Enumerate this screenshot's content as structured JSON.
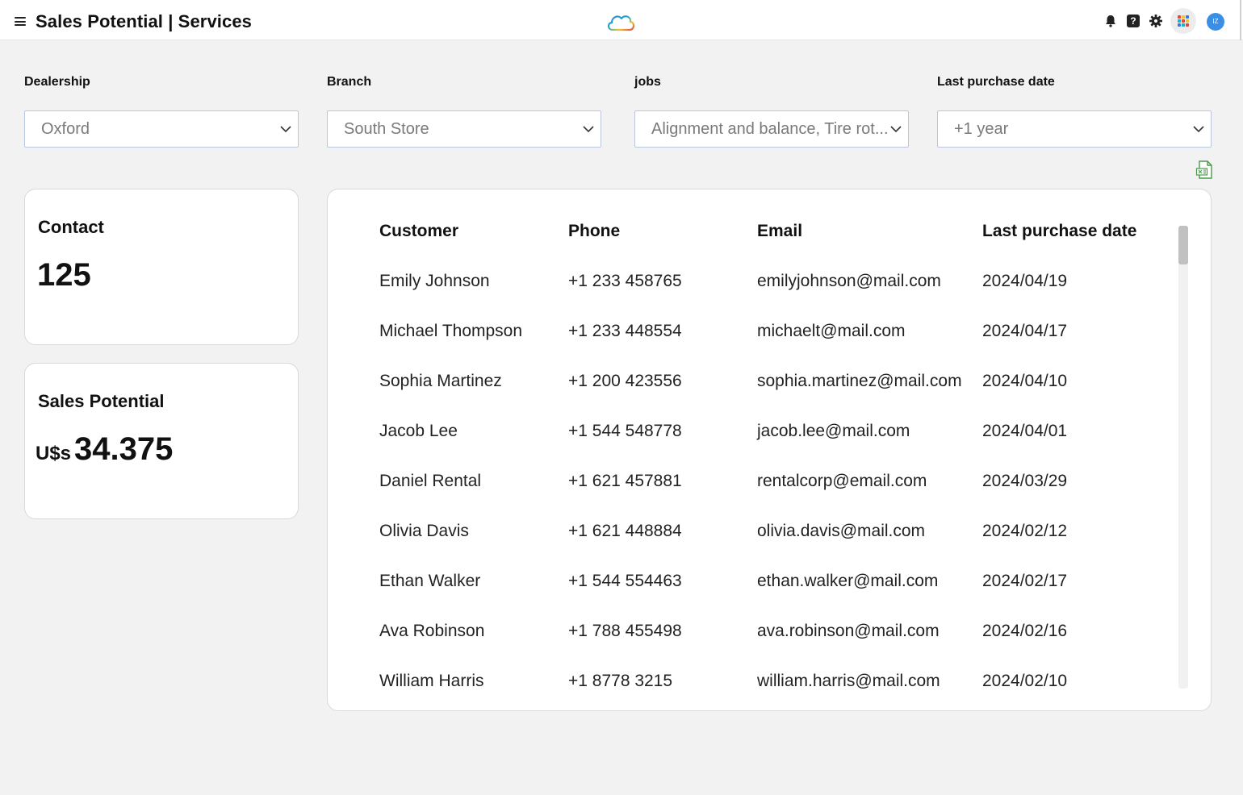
{
  "header": {
    "title": "Sales Potential | Services",
    "icons": [
      "menu-icon",
      "cloud-logo",
      "bell-icon",
      "help-icon",
      "gear-icon",
      "apps-icon"
    ],
    "avatar_initials": "IZ"
  },
  "filters": [
    {
      "label": "Dealership",
      "value": "Oxford"
    },
    {
      "label": "Branch",
      "value": "South Store"
    },
    {
      "label": "jobs",
      "value": "Alignment and balance, Tire rot..."
    },
    {
      "label": "Last purchase date",
      "value": "+1 year"
    }
  ],
  "contact_card": {
    "title": "Contact",
    "value": "125"
  },
  "sales_card": {
    "title": "Sales Potential",
    "currency": "U$s",
    "value": "34.375"
  },
  "table": {
    "columns": [
      "Customer",
      "Phone",
      "Email",
      "Last purchase date"
    ],
    "rows": [
      {
        "customer": "Emily Johnson",
        "phone": "+1 233 458765",
        "email": "emilyjohnson@mail.com",
        "date": "2024/04/19"
      },
      {
        "customer": "Michael Thompson",
        "phone": "+1 233 448554",
        "email": "michaelt@mail.com",
        "date": "2024/04/17"
      },
      {
        "customer": "Sophia Martinez",
        "phone": "+1 200 423556",
        "email": "sophia.martinez@mail.com",
        "date": "2024/04/10"
      },
      {
        "customer": "Jacob Lee",
        "phone": "+1 544 548778",
        "email": "jacob.lee@mail.com",
        "date": "2024/04/01"
      },
      {
        "customer": "Daniel Rental",
        "phone": "+1 621 457881",
        "email": "rentalcorp@email.com",
        "date": "2024/03/29"
      },
      {
        "customer": "Olivia Davis",
        "phone": "+1 621 448884",
        "email": "olivia.davis@mail.com",
        "date": "2024/02/12"
      },
      {
        "customer": "Ethan Walker",
        "phone": "+1 544 554463",
        "email": "ethan.walker@mail.com",
        "date": "2024/02/17"
      },
      {
        "customer": "Ava Robinson",
        "phone": "+1 788 455498",
        "email": "ava.robinson@mail.com",
        "date": "2024/02/16"
      },
      {
        "customer": "William Harris",
        "phone": "+1 8778 3215",
        "email": "william.harris@mail.com",
        "date": "2024/02/10"
      }
    ]
  },
  "colors": {
    "background": "#f2f2f2",
    "select_border": "#b9c7dc",
    "avatar": "#3a8ee6",
    "export_icon": "#4a9a4a"
  }
}
